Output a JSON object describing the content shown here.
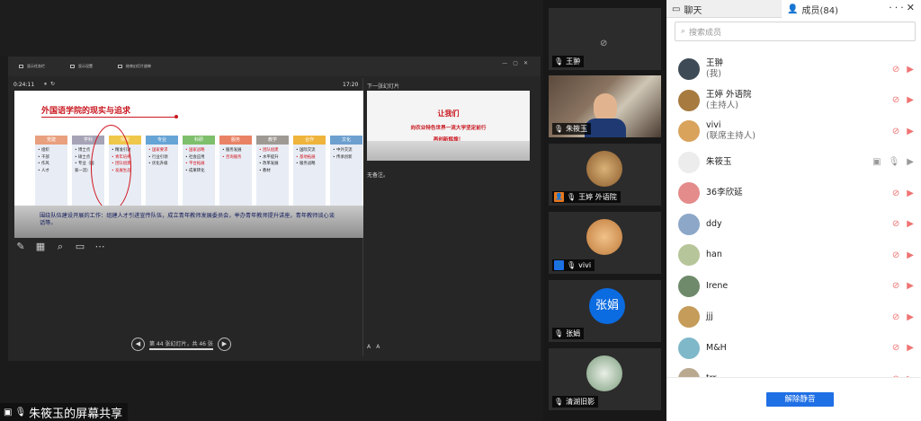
{
  "share": {
    "toolbar": [
      {
        "label": "显示任务栏"
      },
      {
        "label": "显示设置"
      },
      {
        "label": "结束幻灯片放映"
      }
    ],
    "timer": "0:24:11",
    "clock": "17:20",
    "next_slide_label": "下一张幻灯片",
    "slide": {
      "title": "外国语学院的现实与追求",
      "columns": [
        {
          "head": "党建",
          "color": "#e9a07f",
          "items": [
            {
              "t": "• 组织",
              "red": false
            },
            {
              "t": "• 干部",
              "red": false
            },
            {
              "t": "• 作风",
              "red": false
            },
            {
              "t": "• 人才",
              "red": false
            }
          ]
        },
        {
          "head": "学科",
          "color": "#a5a3b5",
          "items": [
            {
              "t": "• 博士点",
              "red": false
            },
            {
              "t": "• 硕士点",
              "red": false
            },
            {
              "t": "• 专业（国",
              "red": false
            },
            {
              "t": "  家一流）",
              "red": false
            }
          ]
        },
        {
          "head": "师资",
          "color": "#efc74a",
          "items": [
            {
              "t": "• 精准引进",
              "red": false
            },
            {
              "t": "• 青年培养",
              "red": true
            },
            {
              "t": "• 团队组建",
              "red": true
            },
            {
              "t": "• 发展生态",
              "red": true
            }
          ]
        },
        {
          "head": "专业",
          "color": "#67a4d6",
          "items": [
            {
              "t": "• 国家要求",
              "red": true
            },
            {
              "t": "• 行业引领",
              "red": false
            },
            {
              "t": "• 优化升级",
              "red": false
            }
          ]
        },
        {
          "head": "科研",
          "color": "#7ebf6c",
          "items": [
            {
              "t": "• 国家战略",
              "red": true
            },
            {
              "t": "• 社会应用",
              "red": false
            },
            {
              "t": "• 平台拓展",
              "red": true
            },
            {
              "t": "• 成果转化",
              "red": false
            }
          ]
        },
        {
          "head": "服务",
          "color": "#e98265",
          "items": [
            {
              "t": "• 服务发展",
              "red": false
            },
            {
              "t": "• 咨询服务",
              "red": true
            }
          ]
        },
        {
          "head": "教学",
          "color": "#9e9a93",
          "items": [
            {
              "t": "• 团队组建",
              "red": true
            },
            {
              "t": "• 水平提升",
              "red": false
            },
            {
              "t": "• 改革发展",
              "red": false
            },
            {
              "t": "• 教材",
              "red": false
            }
          ]
        },
        {
          "head": "合作",
          "color": "#efb43c",
          "items": [
            {
              "t": "• 国际交流",
              "red": false
            },
            {
              "t": "• 基地拓展",
              "red": true
            },
            {
              "t": "• 服务战略",
              "red": false
            }
          ]
        },
        {
          "head": "文化",
          "color": "#6ea0cf",
          "items": [
            {
              "t": "• 中外交流",
              "red": false
            },
            {
              "t": "• 传承创新",
              "red": false
            }
          ]
        }
      ],
      "note": "围绕队伍建设开展的工作：组建人才引进宣传队伍，成立青年教师发展委员会，举办青年教师提升讲座，青年教师谈心谈话等。"
    },
    "next_slide": {
      "line1": "让我们",
      "line2": "向农业特色世界一流大学坚定前行",
      "line3": "再创新辉煌！"
    },
    "notes_text": "无备注。",
    "pager": {
      "text": "第 44 张幻灯片，共 46 张"
    },
    "badge_text": "朱筱玉的屏幕共享"
  },
  "tiles": [
    {
      "name": "王翀",
      "kind": "cam-off"
    },
    {
      "name": "朱筱玉",
      "kind": "video"
    },
    {
      "name": "王婷 外语院",
      "kind": "avatar",
      "host": "orange"
    },
    {
      "name": "vivi",
      "kind": "avatar",
      "host": "blue"
    },
    {
      "name": "张娟",
      "kind": "text-avatar",
      "avatar_text": "张娟"
    },
    {
      "name": "清湖旧影",
      "kind": "avatar"
    }
  ],
  "panel": {
    "tab_chat": "聊天",
    "tab_members": "成员(84)",
    "search_placeholder": "搜索成员",
    "members": [
      {
        "name": "王翀",
        "role": "(我)",
        "av": "#3e4a56"
      },
      {
        "name": "王婷 外语院",
        "role": "(主持人)",
        "av": "#a77a3f"
      },
      {
        "name": "vivi",
        "role": "(联席主持人)",
        "av": "#d9a35c"
      },
      {
        "name": "朱筱玉",
        "role": "",
        "av": "#ececec",
        "sharing": true
      },
      {
        "name": "36李欣延",
        "role": "",
        "av": "#e48b8b"
      },
      {
        "name": "ddy",
        "role": "",
        "av": "#8da7c9"
      },
      {
        "name": "han",
        "role": "",
        "av": "#b7c59a"
      },
      {
        "name": "Irene",
        "role": "",
        "av": "#6e8a6a"
      },
      {
        "name": "jjj",
        "role": "",
        "av": "#c59c5a"
      },
      {
        "name": "M&H",
        "role": "",
        "av": "#7fb8c9"
      },
      {
        "name": "trr",
        "role": "",
        "av": "#b9a98f"
      }
    ],
    "unmute_all": "解除静音"
  }
}
